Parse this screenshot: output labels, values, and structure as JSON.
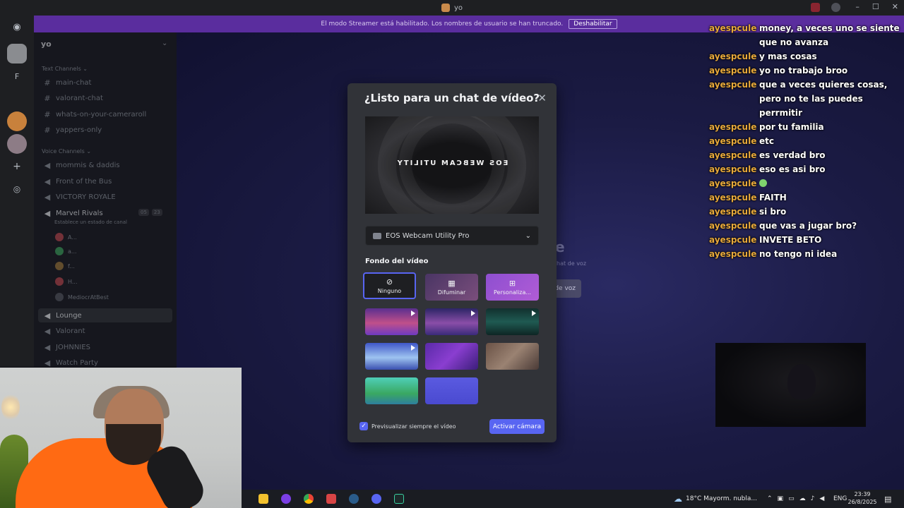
{
  "window": {
    "title": "yo",
    "controls": [
      "–",
      "☐",
      "✕"
    ]
  },
  "streamer": {
    "message": "El modo Streamer está habilitado. Los nombres de usuario se han truncado.",
    "disable_label": "Deshabilitar"
  },
  "rail": {
    "letter": "F"
  },
  "server": {
    "name": "yo"
  },
  "sidebar": {
    "text_category": "Text Channels",
    "text_channels": [
      "main-chat",
      "valorant-chat",
      "whats-on-your-cameraroll",
      "yappers-only"
    ],
    "voice_category": "Voice Channels",
    "voice_channels": [
      "mommis & daddis",
      "Front of the Bus",
      "VICTORY ROYALE",
      "Marvel Rivals"
    ],
    "vc_status": "Establece un estado de canal",
    "vc_counts": [
      "05",
      "23"
    ],
    "members": [
      "A...",
      "a...",
      "f...",
      "H...",
      "MediocrAtBest"
    ],
    "lower_channels": [
      "Lounge",
      "Valorant",
      "JOHNNIES",
      "Watch Party"
    ]
  },
  "background": {
    "partial_title": "e",
    "partial_sub": "hat de voz",
    "partial_btn": "de voz"
  },
  "modal": {
    "title": "¿Listo para un chat de vídeo?",
    "preview_text": "EOS WEBCAM UTILITY",
    "camera_select": "EOS Webcam Utility Pro",
    "section_label": "Fondo del vídeo",
    "options": [
      {
        "label": "Ninguno",
        "icon": "⊘"
      },
      {
        "label": "Difuminar",
        "icon": "▦"
      },
      {
        "label": "Personaliza...",
        "icon": "⊞"
      }
    ],
    "checkbox_label": "Previsualizar siempre el vídeo",
    "activate_label": "Activar cámara"
  },
  "chat": [
    {
      "user": "ayespcule",
      "text": "money, a veces uno se siente que no avanza"
    },
    {
      "user": "ayespcule",
      "text": "y mas cosas"
    },
    {
      "user": "ayespcule",
      "text": "yo no trabajo broo"
    },
    {
      "user": "ayespcule",
      "text": "que a veces quieres cosas, pero no te las puedes perrmitir"
    },
    {
      "user": "ayespcule",
      "text": "por tu familia"
    },
    {
      "user": "ayespcule",
      "text": "etc"
    },
    {
      "user": "ayespcule",
      "text": "es verdad bro"
    },
    {
      "user": "ayespcule",
      "text": "eso es asi bro"
    },
    {
      "user": "ayespcule",
      "text": ""
    },
    {
      "user": "ayespcule",
      "text": "FAITH"
    },
    {
      "user": "ayespcule",
      "text": "si bro"
    },
    {
      "user": "ayespcule",
      "text": "que vas a jugar bro?"
    },
    {
      "user": "ayespcule",
      "text": "INVETE BETO"
    },
    {
      "user": "ayespcule",
      "text": "no tengo ni idea"
    }
  ],
  "taskbar": {
    "weather": "18°C  Mayorm. nubla...",
    "lang": "ENG",
    "time": "23:39",
    "date": "26/8/2025"
  },
  "colors": {
    "accent": "#5865f2",
    "streamer": "#5a2d9e",
    "username": "#e7a93b"
  }
}
